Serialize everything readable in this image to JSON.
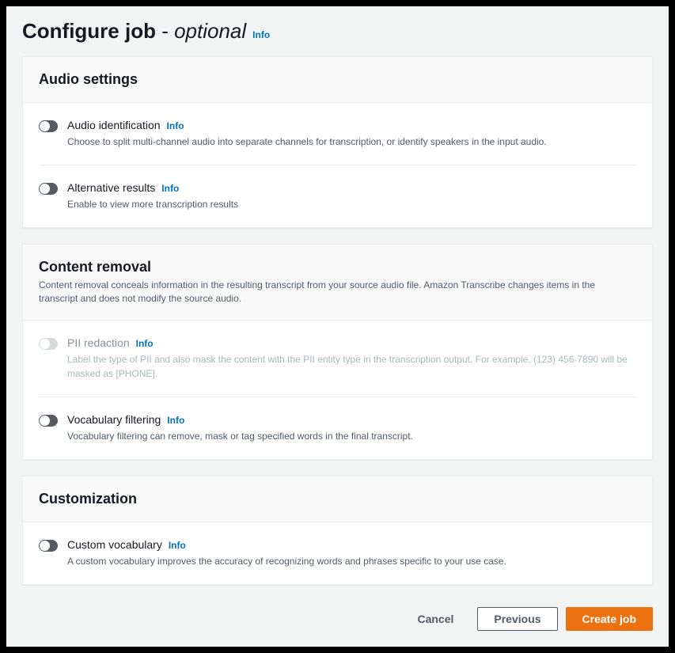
{
  "header": {
    "title_main": "Configure job",
    "title_separator": " - ",
    "title_suffix": "optional",
    "info": "Info"
  },
  "sections": {
    "audio": {
      "title": "Audio settings",
      "items": {
        "identification": {
          "label": "Audio identification",
          "info": "Info",
          "description": "Choose to split multi-channel audio into separate channels for transcription, or identify speakers in the input audio."
        },
        "alternative": {
          "label": "Alternative results",
          "info": "Info",
          "description": "Enable to view more transcription results"
        }
      }
    },
    "content_removal": {
      "title": "Content removal",
      "subtitle": "Content removal conceals information in the resulting transcript from your source audio file. Amazon Transcribe changes items in the transcript and does not modify the source audio.",
      "items": {
        "pii": {
          "label": "PII redaction",
          "info": "Info",
          "description": "Label the type of PII and also mask the content with the PII entity type in the transcription output. For example, (123) 456-7890 will be masked as [PHONE]."
        },
        "vocab_filter": {
          "label": "Vocabulary filtering",
          "info": "Info",
          "description": "Vocabulary filtering can remove, mask or tag specified words in the final transcript."
        }
      }
    },
    "customization": {
      "title": "Customization",
      "items": {
        "custom_vocab": {
          "label": "Custom vocabulary",
          "info": "Info",
          "description": "A custom vocabulary improves the accuracy of recognizing words and phrases specific to your use case."
        }
      }
    }
  },
  "footer": {
    "cancel": "Cancel",
    "previous": "Previous",
    "create": "Create job"
  }
}
